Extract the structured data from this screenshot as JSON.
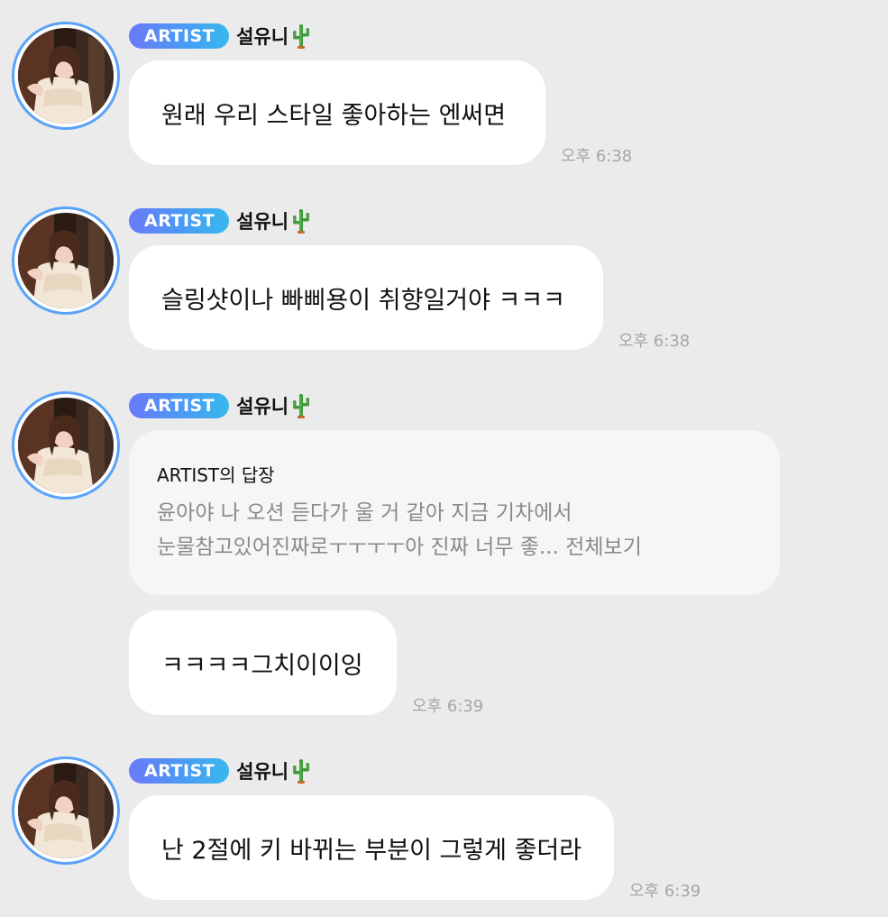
{
  "messages": [
    {
      "badge": "ARTIST",
      "sender": "설유니",
      "sender_icon": "cactus-icon",
      "text": "원래 우리 스타일 좋아하는 엔써면",
      "time": "오후 6:38"
    },
    {
      "badge": "ARTIST",
      "sender": "설유니",
      "sender_icon": "cactus-icon",
      "text": "슬링샷이나 빠삐용이 취향일거야 ㅋㅋㅋ",
      "time": "오후 6:38"
    },
    {
      "badge": "ARTIST",
      "sender": "설유니",
      "sender_icon": "cactus-icon",
      "reply": {
        "title": "ARTIST의 답장",
        "line1": "윤아야 나 오션 듣다가 울 거 같아 지금 기차에서",
        "line2": "눈물참고있어진짜로ㅜㅜㅜㅜ아 진짜 너무 좋...",
        "more": "전체보기"
      },
      "text": "ㅋㅋㅋㅋ그치이이잉",
      "time": "오후 6:39"
    },
    {
      "badge": "ARTIST",
      "sender": "설유니",
      "sender_icon": "cactus-icon",
      "text": "난 2절에 키 바뀌는 부분이 그렇게 좋더라",
      "time": "오후 6:39"
    }
  ],
  "colors": {
    "background": "#ebebeb",
    "bubble": "#ffffff",
    "reply_bubble": "#f6f6f6",
    "badge_gradient_start": "#6b79fb",
    "badge_gradient_end": "#38b8ee",
    "avatar_ring": "#5aa2f7",
    "time_text": "#a6a6a6"
  }
}
